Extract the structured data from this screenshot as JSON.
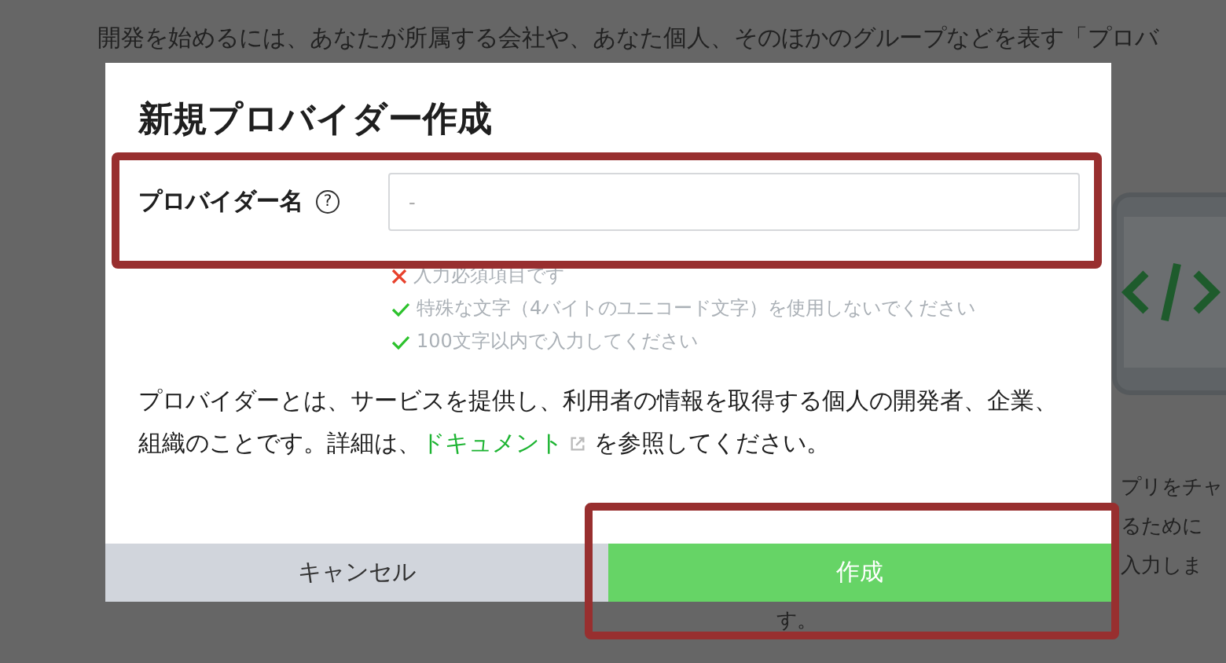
{
  "background": {
    "intro": "開発を始めるには、あなたが所属する会社や、あなた個人、そのほかのグループなどを表す「プロバ",
    "side_lines": [
      "プリをチャ",
      "るために",
      "入力しま"
    ],
    "tail": "す。"
  },
  "dialog": {
    "title": "新規プロバイダー作成",
    "field": {
      "label": "プロバイダー名",
      "help_glyph": "?",
      "placeholder": "-"
    },
    "rules": [
      {
        "kind": "error",
        "text": "入力必須項目です"
      },
      {
        "kind": "ok",
        "text": "特殊な文字（4バイトのユニコード文字）を使用しないでください"
      },
      {
        "kind": "ok",
        "text": "100文字以内で入力してください"
      }
    ],
    "description": {
      "before": "プロバイダーとは、サービスを提供し、利用者の情報を取得する個人の開発者、企業、組織のことです。詳細は、",
      "link": "ドキュメント",
      "after": "を参照してください。"
    },
    "buttons": {
      "cancel": "キャンセル",
      "create": "作成"
    }
  }
}
